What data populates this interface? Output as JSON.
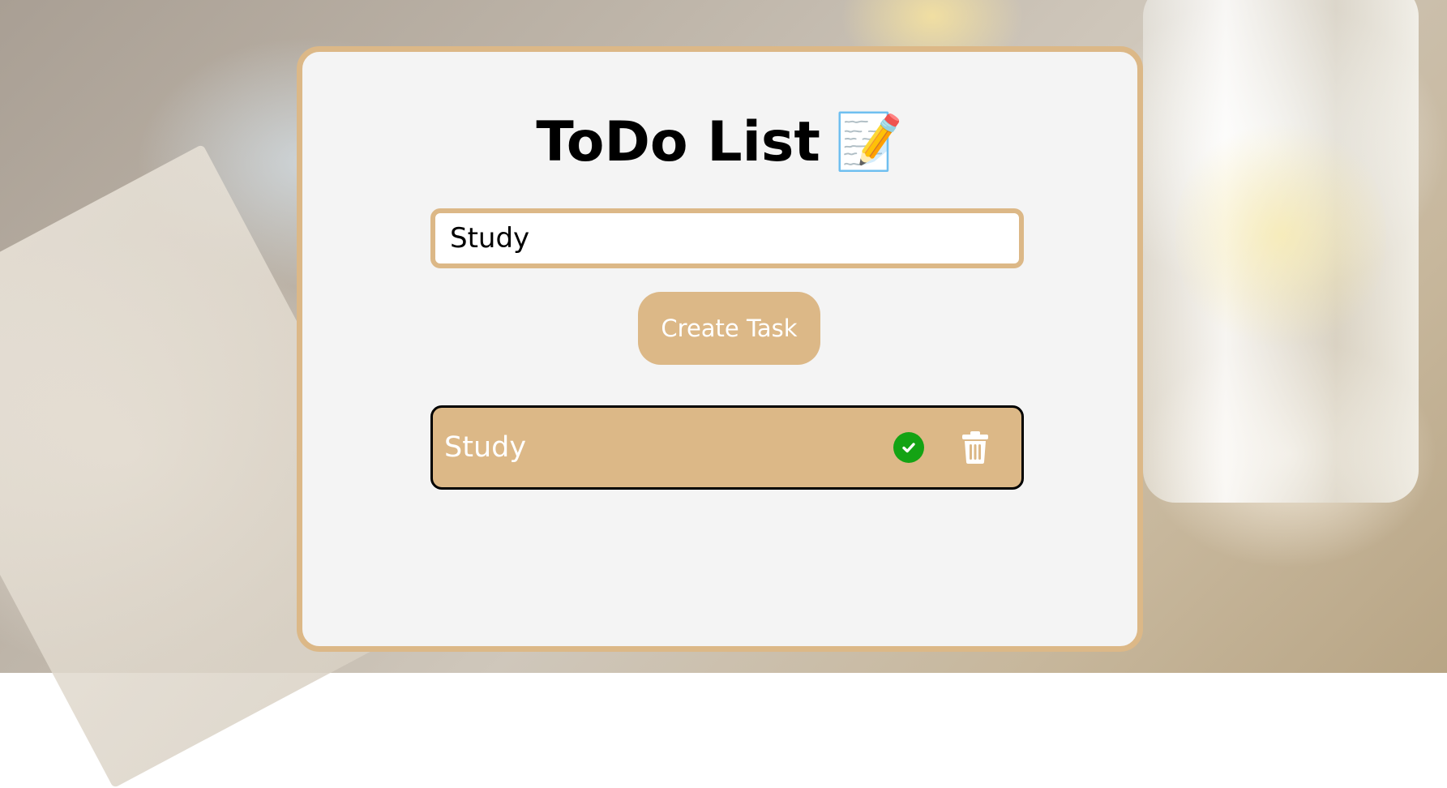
{
  "app": {
    "title": "ToDo List",
    "title_emoji": "📝"
  },
  "form": {
    "input_value": "Study",
    "create_button_label": "Create Task"
  },
  "tasks": [
    {
      "text": "Study",
      "complete_icon": "check-circle-icon",
      "delete_icon": "trash-icon"
    }
  ],
  "colors": {
    "accent": "#dcb887",
    "card_background": "#f4f4f4",
    "complete_green": "#14a314",
    "task_text": "#ffffff"
  }
}
